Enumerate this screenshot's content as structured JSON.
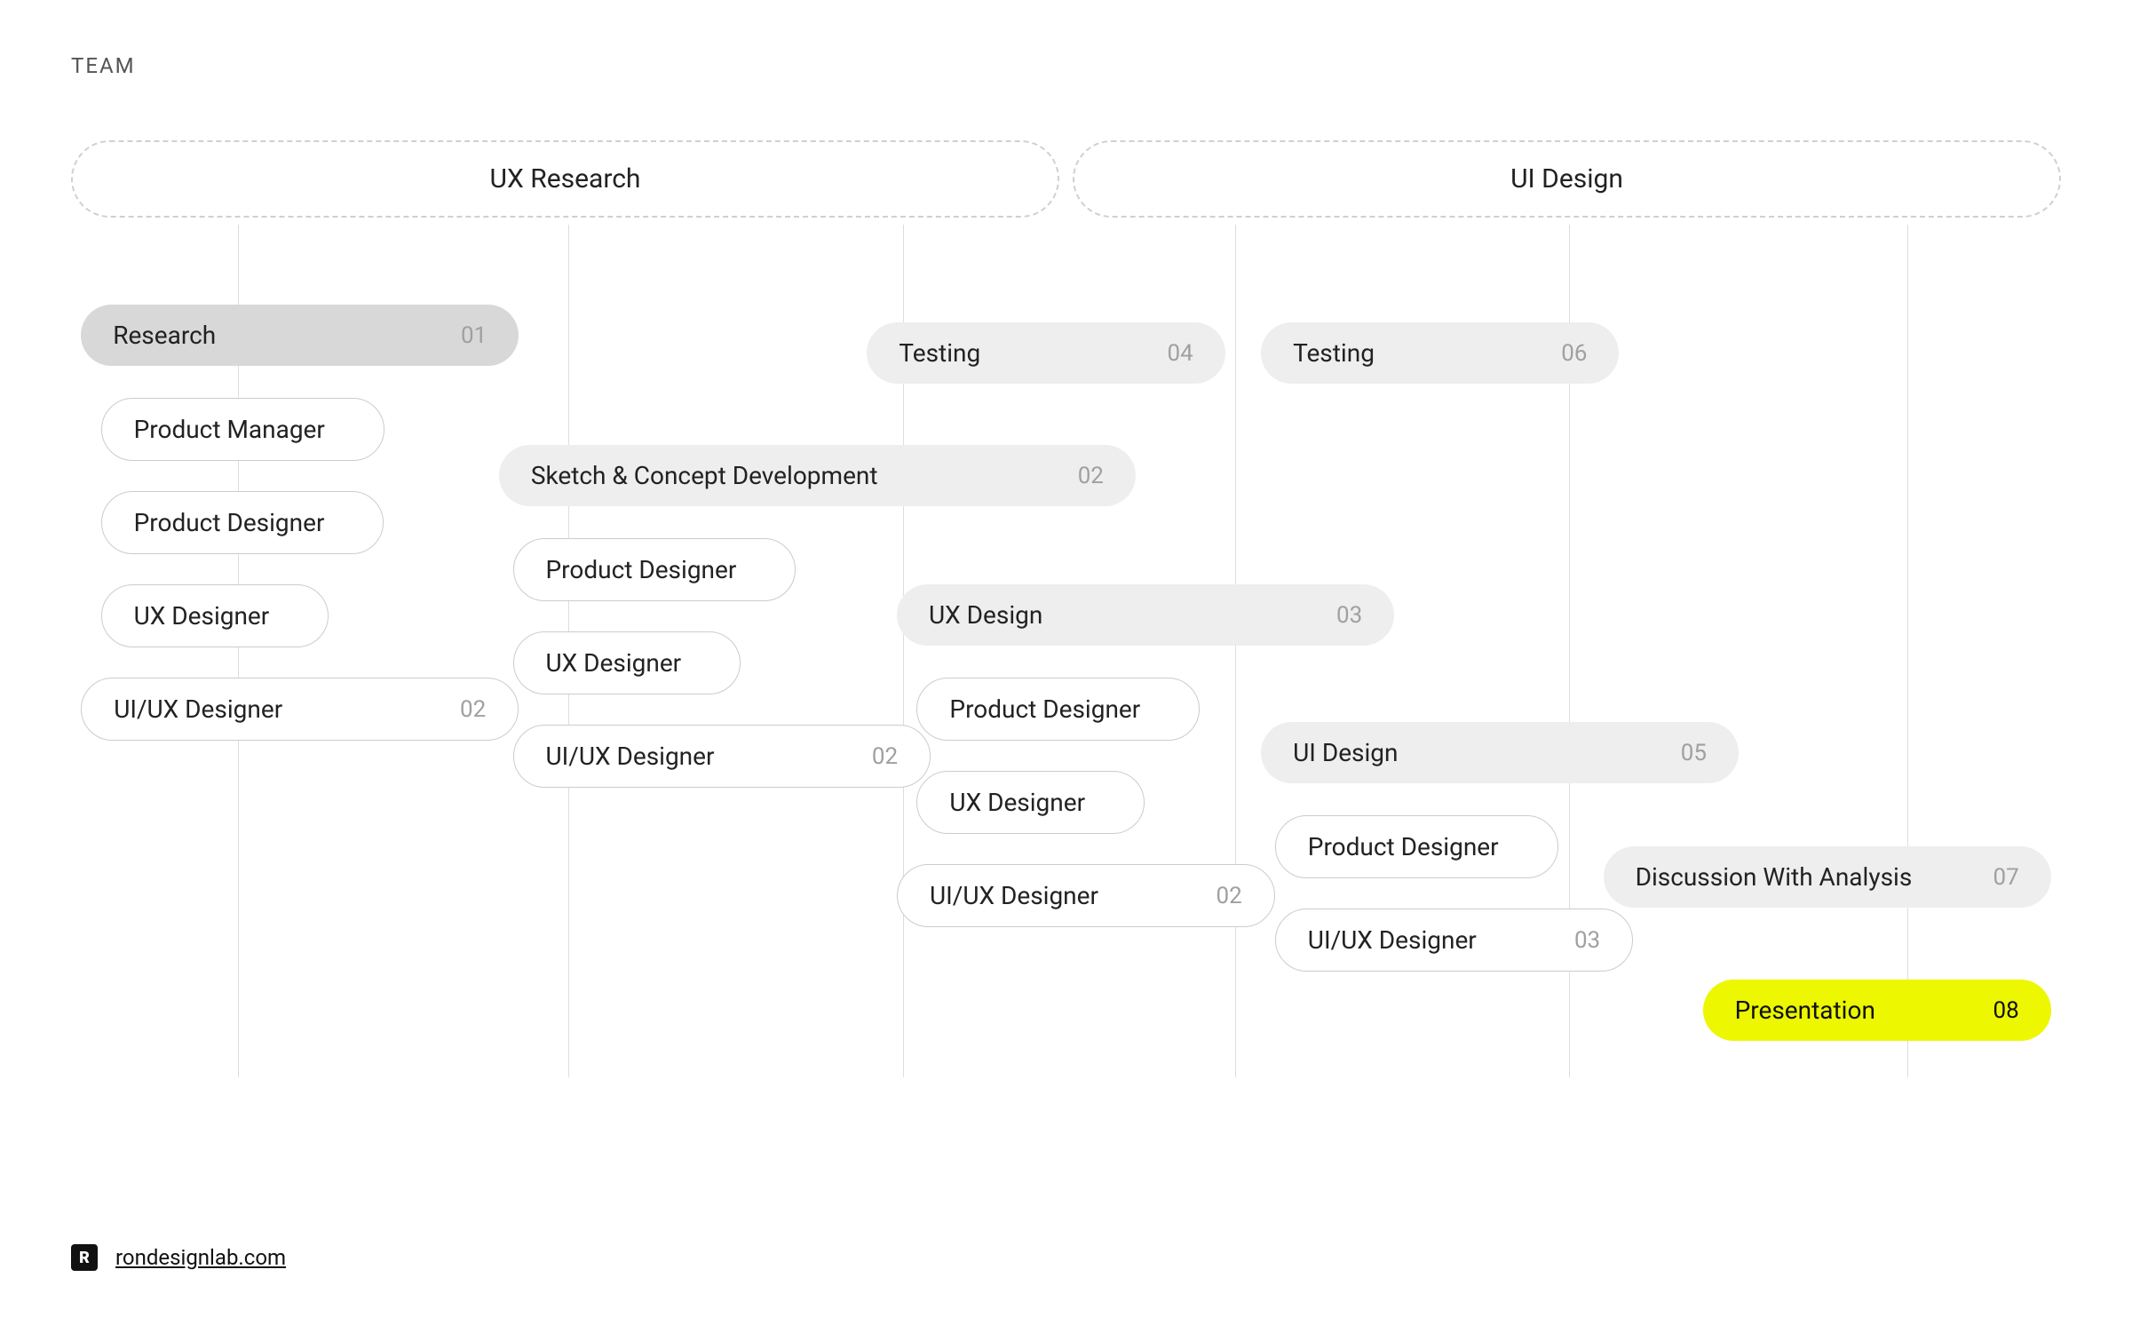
{
  "title": "TEAM",
  "sections": {
    "ux": "UX Research",
    "ui": "UI Design"
  },
  "phases": {
    "research": {
      "label": "Research",
      "num": "01"
    },
    "sketch": {
      "label": "Sketch & Concept Development",
      "num": "02"
    },
    "testing1": {
      "label": "Testing",
      "num": "04"
    },
    "testing2": {
      "label": "Testing",
      "num": "06"
    },
    "uxdesign": {
      "label": "UX Design",
      "num": "03"
    },
    "uidesign": {
      "label": "UI Design",
      "num": "05"
    },
    "discussion": {
      "label": "Discussion With Analysis",
      "num": "07"
    },
    "presentation": {
      "label": "Presentation",
      "num": "08"
    }
  },
  "roles": {
    "pm": "Product Manager",
    "pd1": "Product Designer",
    "uxd1": "UX Designer",
    "uiux1": {
      "label": "UI/UX Designer",
      "num": "02"
    },
    "pd2": "Product Designer",
    "uxd2": "UX Designer",
    "uiux2": {
      "label": "UI/UX Designer",
      "num": "02"
    },
    "pd3": "Product Designer",
    "uxd3": "UX Designer",
    "uiux3": {
      "label": "UI/UX Designer",
      "num": "02"
    },
    "pd4": "Product Designer",
    "uiux4": {
      "label": "UI/UX Designer",
      "num": "03"
    }
  },
  "footer": {
    "logoLetter": "R",
    "link": "rondesignlab.com"
  }
}
